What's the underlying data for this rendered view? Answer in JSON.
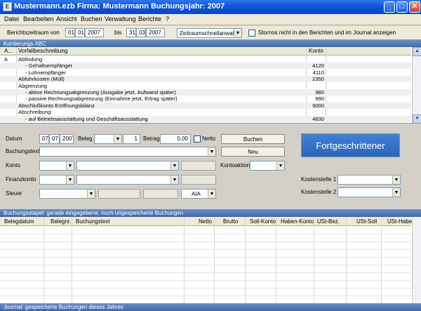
{
  "window": {
    "title": "Mustermann.ezb   Firma: Mustermann   Buchungsjahr: 2007",
    "icon_glyph": "E",
    "minimize_glyph": "_",
    "maximize_glyph": "□",
    "close_glyph": "✕"
  },
  "menu": [
    "Datei",
    "Bearbeiten",
    "Ansicht",
    "Buchen",
    "Verwaltung",
    "Berichte",
    "?"
  ],
  "filter": {
    "label": "Berichtszeitraum von",
    "from_day": "01",
    "from_month": "01",
    "from_year": "2007",
    "bis_label": "bis",
    "to_day": "31",
    "to_month": "03",
    "to_year": "2007",
    "quick_select": "Zeitraumschnellanwahl",
    "storno_label": "Stornos nicht in den Berichten und im Journal anzeigen"
  },
  "kontierung": {
    "section_title": "Kontierungs ABC",
    "col_a": "A...",
    "col_desc": "Vorfallbeschreibung",
    "col_konto": "Konto",
    "rows": [
      {
        "letter": "A",
        "indent": 0,
        "text": "Abfindung",
        "konto": ""
      },
      {
        "letter": "",
        "indent": 2,
        "text": "- Gehaltsempfänger",
        "konto": "4120"
      },
      {
        "letter": "",
        "indent": 2,
        "text": "- Lohnempfänger",
        "konto": "4110"
      },
      {
        "letter": "",
        "indent": 0,
        "text": "Abfuhrkosten (Müll)",
        "konto": "2350"
      },
      {
        "letter": "",
        "indent": 0,
        "text": "Abgrenzung",
        "konto": ""
      },
      {
        "letter": "",
        "indent": 1,
        "text": "- aktive Rechnungsabgrenzung (Ausgabe jetzt, Aufwand später)",
        "konto": "980"
      },
      {
        "letter": "",
        "indent": 1,
        "text": "- passive Rechnungsabgrenzung (Einnahme jetzt, Ertrag später)",
        "konto": "990"
      },
      {
        "letter": "",
        "indent": 0,
        "text": "Abschlußkonto Eröffnungsbilanz",
        "konto": "9000"
      },
      {
        "letter": "",
        "indent": 0,
        "text": "Abschreibung",
        "konto": ""
      },
      {
        "letter": "",
        "indent": 1,
        "text": "- auf Betriebsausstattung und Geschäftsausstattung",
        "konto": "4830"
      }
    ],
    "scroll_up_glyph": "▲",
    "scroll_down_glyph": "▼"
  },
  "entry": {
    "datum_label": "Datum",
    "datum_day": "07",
    "datum_month": "07",
    "datum_year": "2007",
    "beleg_label": "Beleg",
    "beleg_number": "1",
    "betrag_label": "Betrag",
    "betrag_value": "0,00",
    "netto_label": "Netto",
    "buchen_button": "Buchen",
    "neu_button": "Neu",
    "buchungstext_label": "Buchungstext",
    "konto_label": "Konto",
    "kontoaktion_label": "Kontoaktion",
    "finanzkonto_label": "Finanzkonto",
    "steuer_label": "Steuer",
    "aia_label": "AIA",
    "kostenstelle1_label": "Kostenstelle 1",
    "kostenstelle2_label": "Kostenstelle 2",
    "mode_button": "Fortgeschrittener",
    "dropdown_glyph": "▼"
  },
  "stapel": {
    "section_title": "Buchungsstapel: gerade eingegebene, noch ungespeicherte Buchungen",
    "columns": [
      "Belegdatum",
      "Belegnr.",
      "Buchungstext",
      "Netto",
      "Brutto",
      "Soll-Konto",
      "Haben-Konto",
      "USt-Bez.",
      "USt-Soll",
      "USt-Haben"
    ]
  },
  "journal": {
    "section_title": "Journal: gespeicherte Buchungen dieses Jahres"
  },
  "colors": {
    "titlebar": "#0b46c4",
    "section_header": "#3e68aa",
    "mode_button": "#2d64b9"
  }
}
